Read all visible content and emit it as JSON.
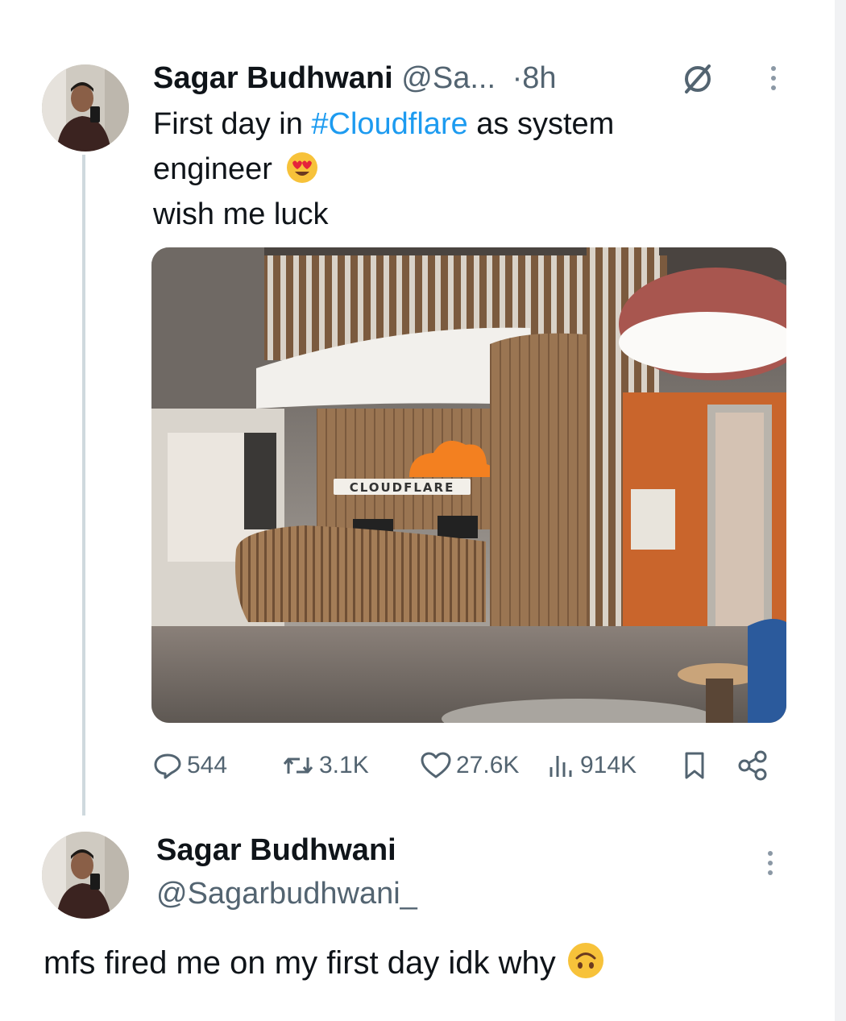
{
  "tweet": {
    "author_name": "Sagar Budhwani",
    "handle_truncated": "@Sa...",
    "separator": "·",
    "time": "8h",
    "text_line1_before": "First day in ",
    "hashtag": "#Cloudflare",
    "text_line1_after": " as system",
    "text_line2": "engineer",
    "text_line3": "wish me luck",
    "emoji_name": "heart-eyes-emoji",
    "media_sign_text": "CLOUDFLARE",
    "stats": {
      "replies": "544",
      "retweets": "3.1K",
      "likes": "27.6K",
      "views": "914K"
    }
  },
  "reply": {
    "author_name": "Sagar Budhwani",
    "handle": "@Sagarbudhwani_",
    "text": "mfs fired me on my first day idk why",
    "emoji_name": "upside-down-face-emoji"
  },
  "colors": {
    "link_blue": "#1d9bf0",
    "muted_gray": "#536471",
    "text_dark": "#0f1419",
    "cloudflare_orange": "#f38020"
  }
}
